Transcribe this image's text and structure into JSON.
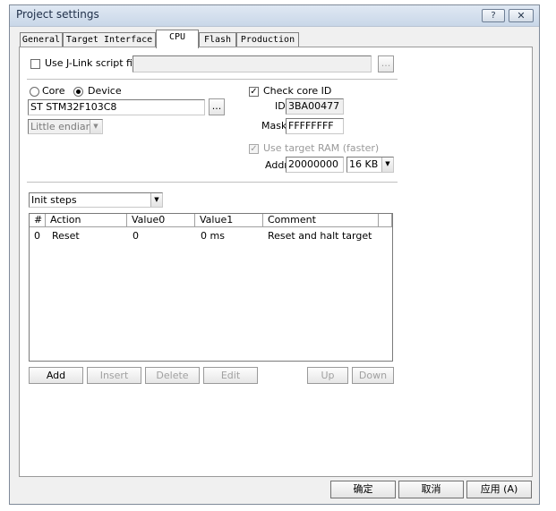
{
  "window": {
    "title": "Project settings",
    "help_button": "?",
    "close_button": "x"
  },
  "tabs": [
    {
      "label": "General"
    },
    {
      "label": "Target Interface"
    },
    {
      "label": "CPU"
    },
    {
      "label": "Flash"
    },
    {
      "label": "Production"
    }
  ],
  "script_file": {
    "checkbox_label": "Use J-Link script file",
    "value": "",
    "browse_label": "..."
  },
  "core_select": {
    "core_label": "Core",
    "device_label": "Device",
    "selected": "Device"
  },
  "device": {
    "value": "ST STM32F103C8",
    "browse_label": "..."
  },
  "endian": {
    "value": "Little endian"
  },
  "core_id": {
    "checkbox_label": "Check core ID",
    "checked": true,
    "id_label": "ID",
    "id_value": "3BA00477",
    "mask_label": "Mask",
    "mask_value": "FFFFFFFF"
  },
  "target_ram": {
    "checkbox_label": "Use target RAM (faster)",
    "checked": true,
    "addr_label": "Addr",
    "addr_value": "20000000",
    "size_value": "16 KB"
  },
  "init_steps": {
    "dropdown_value": "Init steps",
    "columns": [
      "#",
      "Action",
      "Value0",
      "Value1",
      "Comment"
    ],
    "rows": [
      {
        "num": "0",
        "action": "Reset",
        "value0": "0",
        "value1": "0 ms",
        "comment": "Reset and halt target"
      }
    ],
    "buttons": {
      "add": "Add",
      "insert": "Insert",
      "delete": "Delete",
      "edit": "Edit",
      "up": "Up",
      "down": "Down"
    }
  },
  "footer": {
    "ok": "确定",
    "cancel": "取消",
    "apply": "应用 (A)"
  }
}
